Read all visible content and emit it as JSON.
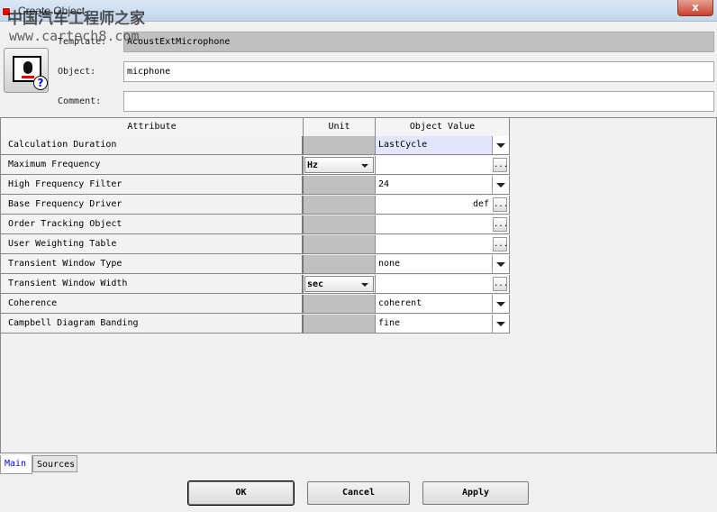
{
  "window": {
    "title": "Create Object",
    "close_label": "x"
  },
  "watermark": {
    "text": "中国汽车工程师之家",
    "url": "www.cartech8.com"
  },
  "form": {
    "template_label": "Template:",
    "template_value": "AcoustExtMicrophone",
    "object_label": "Object:",
    "object_value": "micphone",
    "comment_label": "Comment:",
    "comment_value": ""
  },
  "table": {
    "headers": [
      "Attribute",
      "Unit",
      "Object Value"
    ],
    "rows": [
      {
        "attribute": "Calculation Duration",
        "unit": null,
        "value": "LastCycle",
        "control": "dropdown",
        "selected": true
      },
      {
        "attribute": "Maximum Frequency",
        "unit": "Hz",
        "value": "",
        "control": "browse"
      },
      {
        "attribute": "High Frequency Filter",
        "unit": null,
        "value": "24",
        "control": "dropdown"
      },
      {
        "attribute": "Base Frequency Driver",
        "unit": null,
        "value": "def",
        "control": "browse-right"
      },
      {
        "attribute": "Order Tracking Object",
        "unit": null,
        "value": "",
        "control": "browse"
      },
      {
        "attribute": "User Weighting Table",
        "unit": null,
        "value": "",
        "control": "browse"
      },
      {
        "attribute": "Transient Window Type",
        "unit": null,
        "value": "none",
        "control": "dropdown"
      },
      {
        "attribute": "Transient Window Width",
        "unit": "sec",
        "value": "",
        "control": "browse"
      },
      {
        "attribute": "Coherence",
        "unit": null,
        "value": "coherent",
        "control": "dropdown"
      },
      {
        "attribute": "Campbell Diagram Banding",
        "unit": null,
        "value": "fine",
        "control": "dropdown"
      }
    ]
  },
  "tabs": [
    {
      "label": "Main",
      "active": true
    },
    {
      "label": "Sources",
      "active": false
    }
  ],
  "buttons": {
    "ok": "OK",
    "cancel": "Cancel",
    "apply": "Apply",
    "browse": "..."
  }
}
